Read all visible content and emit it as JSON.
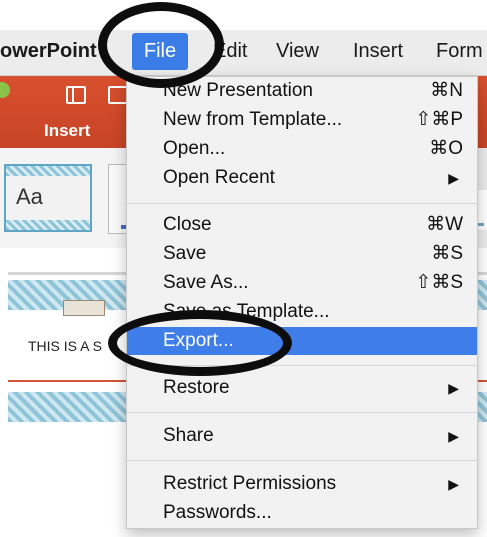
{
  "menubar": {
    "app": "owerPoint",
    "file": "File",
    "edit": "Edit",
    "view": "View",
    "insert": "Insert",
    "format": "Form"
  },
  "ribbon": {
    "tab_insert": "Insert"
  },
  "theme": {
    "preview_text": "Aa"
  },
  "slide": {
    "text": "THIS IS A S"
  },
  "file_menu": {
    "items": [
      {
        "label": "New Presentation",
        "shortcut": "⌘N"
      },
      {
        "label": "New from Template...",
        "shortcut": "⇧⌘P"
      },
      {
        "label": "Open...",
        "shortcut": "⌘O"
      },
      {
        "label": "Open Recent",
        "shortcut": "▶"
      },
      {
        "label": "Close",
        "shortcut": "⌘W"
      },
      {
        "label": "Save",
        "shortcut": "⌘S"
      },
      {
        "label": "Save As...",
        "shortcut": "⇧⌘S"
      },
      {
        "label": "Save as Template..."
      },
      {
        "label": "Export..."
      },
      {
        "label": "Restore",
        "shortcut": "▶"
      },
      {
        "label": "Share",
        "shortcut": "▶"
      },
      {
        "label": "Restrict Permissions",
        "shortcut": "▶"
      },
      {
        "label": "Passwords..."
      }
    ],
    "highlighted_index": 8
  },
  "colors": {
    "highlight": "#3f7ee8",
    "ribbon": "#c74426",
    "annotation": "#0d0d0d"
  }
}
